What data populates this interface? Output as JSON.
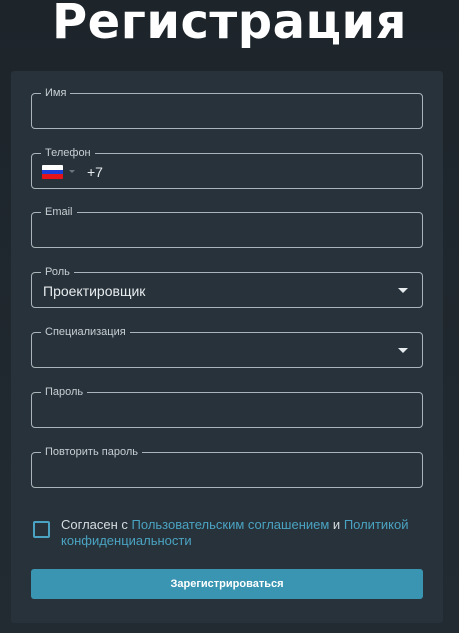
{
  "page": {
    "title": "Регистрация"
  },
  "form": {
    "name": {
      "label": "Имя",
      "value": ""
    },
    "phone": {
      "label": "Телефон",
      "code": "+7",
      "flag_colors": [
        "#ffffff",
        "#1c3fd8",
        "#e3151a"
      ]
    },
    "email": {
      "label": "Email",
      "value": ""
    },
    "role": {
      "label": "Роль",
      "value": "Проектировщик"
    },
    "specialization": {
      "label": "Специализация",
      "value": ""
    },
    "password": {
      "label": "Пароль",
      "value": ""
    },
    "password_repeat": {
      "label": "Повторить пароль",
      "value": ""
    },
    "agreement": {
      "checked": false,
      "text_prefix": "Согласен с ",
      "link_terms": "Пользовательским соглашением",
      "text_middle": " и ",
      "link_privacy": "Политикой конфиденциальности"
    },
    "submit_label": "Зарегистрироваться"
  },
  "colors": {
    "background": "#1f282e",
    "card": "#28323a",
    "accent": "#3a95b2",
    "link": "#4aa3c2"
  }
}
